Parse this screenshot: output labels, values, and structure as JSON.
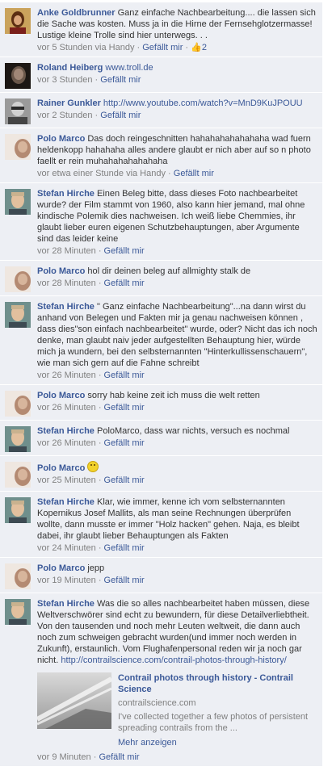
{
  "comments": [
    {
      "author": "Anke Goldbrunner",
      "text": "Ganz einfache Nachbearbeitung.... die lassen sich die Sache was kosten. Muss ja in die Hirne der Fernsehglotzermasse!\nLustige kleine Trolle sind hier unterwegs. . .",
      "time": "vor 5 Stunden via Handy",
      "like": "Gefällt mir",
      "likes": "2",
      "avatar": "avatar-photo"
    },
    {
      "author": "Roland Heiberg",
      "link": "www.troll.de",
      "time": "vor 3 Stunden",
      "like": "Gefällt mir",
      "avatar": "avatar-photo"
    },
    {
      "author": "Rainer Gunkler",
      "link": "http://www.youtube.com/watch?v=MnD9KuJPOUU",
      "time": "vor 2 Stunden",
      "like": "Gefällt mir",
      "avatar": "avatar-photo"
    },
    {
      "author": "Polo Marco",
      "text": "Das doch reingeschnitten hahahahahahahaha wad fuern heldenkopp hahahaha alles andere glaubt er nich aber auf so n photo faellt er rein muhahahahahahaha",
      "time": "vor etwa einer Stunde via Handy",
      "like": "Gefällt mir",
      "avatar": "avatar-photo"
    },
    {
      "author": "Stefan Hirche",
      "text": "Einen Beleg bitte, dass dieses Foto nachbearbeitet wurde? der Film stammt von 1960, also kann hier jemand, mal ohne kindische Polemik dies nachweisen. Ich weiß liebe Chemmies, ihr glaubt lieber euren eigenen Schutzbehauptungen, aber Argumente sind das leider keine",
      "time": "vor 28 Minuten",
      "like": "Gefällt mir",
      "avatar": "avatar-photo"
    },
    {
      "author": "Polo Marco",
      "text": "hol dir deinen beleg auf allmighty stalk de",
      "time": "vor 28 Minuten",
      "like": "Gefällt mir",
      "avatar": "avatar-photo"
    },
    {
      "author": "Stefan Hirche",
      "text": "\" Ganz einfache Nachbearbeitung\"...na dann wirst du anhand von Belegen und Fakten mir ja genau nachweisen können , dass dies\"son einfach nachbearbeitet\" wurde, oder? Nicht das ich noch denke, man glaubt naiv jeder aufgestellten Behauptung hier, würde mich ja wundern, bei den selbsternannten \"Hinterkullissenschauern\", wie man sich gern auf die Fahne schreibt",
      "time": "vor 26 Minuten",
      "like": "Gefällt mir",
      "avatar": "avatar-photo"
    },
    {
      "author": "Polo Marco",
      "text": "sorry hab keine zeit ich muss die welt retten",
      "time": "vor 26 Minuten",
      "like": "Gefällt mir",
      "avatar": "avatar-photo"
    },
    {
      "author": "Stefan Hirche",
      "text": "PoloMarco, dass war nichts, versuch es nochmal",
      "time": "vor 26 Minuten",
      "like": "Gefällt mir",
      "avatar": "avatar-photo"
    },
    {
      "author": "Polo Marco",
      "emoticon": "smile-emoticon",
      "time": "vor 25 Minuten",
      "like": "Gefällt mir",
      "avatar": "avatar-photo"
    },
    {
      "author": "Stefan Hirche",
      "text": "Klar, wie immer, kenne ich vom selbsternannten Kopernikus Josef Mallits, als man seine Rechnungen überprüfen wollte, dann musste er immer \"Holz hacken\" gehen. Naja, es bleibt dabei, ihr glaubt lieber Behauptungen als Fakten",
      "time": "vor 24 Minuten",
      "like": "Gefällt mir",
      "avatar": "avatar-photo"
    },
    {
      "author": "Polo Marco",
      "text": "jepp",
      "time": "vor 19 Minuten",
      "like": "Gefällt mir",
      "avatar": "avatar-photo"
    },
    {
      "author": "Stefan Hirche",
      "text": "Was die so alles nachbearbeitet haben müssen, diese Weltverschwörer sind echt zu bewundern, für diese Detailverliebtheit. Von den tausenden und noch mehr Leuten weltweit, die dann auch noch zum schweigen gebracht wurden(und immer noch werden in Zukunft), erstaunlich. Vom Flughafenpersonal reden wir ja noch gar nicht.",
      "link": "http://contrailscience.com/contrail-photos-through-history/",
      "time": "vor 9 Minuten",
      "like": "Gefällt mir",
      "avatar": "avatar-photo",
      "preview": {
        "title": "Contrail photos through history - Contrail Science",
        "domain": "contrailscience.com",
        "description": "I've collected together a few photos of persistent spreading contrails from the ...",
        "more": "Mehr anzeigen",
        "thumbnail": "contrail-photo"
      }
    }
  ],
  "colors": {
    "link": "#3b5998",
    "comment_bg": "#edeff4",
    "meta": "#808080",
    "text": "#333333"
  }
}
